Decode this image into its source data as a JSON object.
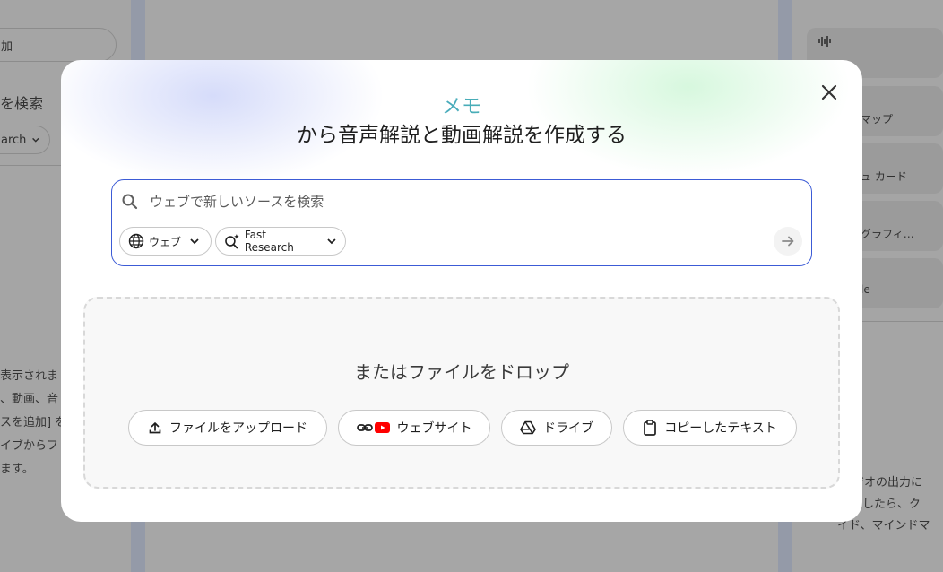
{
  "background": {
    "left_pill": "加",
    "left_heading": "を検索",
    "left_select": "arch",
    "left_lines": [
      "表示されま",
      "、動画、音",
      "スを追加] を",
      "イブからフ",
      "ます。"
    ],
    "right_cards": [
      "マップ",
      "ュ カード",
      "グラフィ…",
      "le"
    ],
    "right_lines": [
      "タジオの出力に",
      "追加したら、ク",
      "イド、マインドマ"
    ]
  },
  "modal": {
    "brand": "メモ",
    "title": "から音声解説と動画解説を作成する",
    "close_icon": "close-icon",
    "search": {
      "placeholder": "ウェブで新しいソースを検索",
      "value": "",
      "source_chip": "ウェブ",
      "mode_chip": "Fast Research",
      "submit_icon": "arrow-right-icon"
    },
    "drop": {
      "text": "またはファイルをドロップ",
      "buttons": {
        "upload": "ファイルをアップロード",
        "website": "ウェブサイト",
        "drive": "ドライブ",
        "paste": "コピーしたテキスト"
      }
    }
  },
  "colors": {
    "accent_blue": "#3c5bd6",
    "youtube_red": "#ff0000",
    "brand_gradient_start": "#4a8ff0",
    "brand_gradient_end": "#46c982"
  }
}
